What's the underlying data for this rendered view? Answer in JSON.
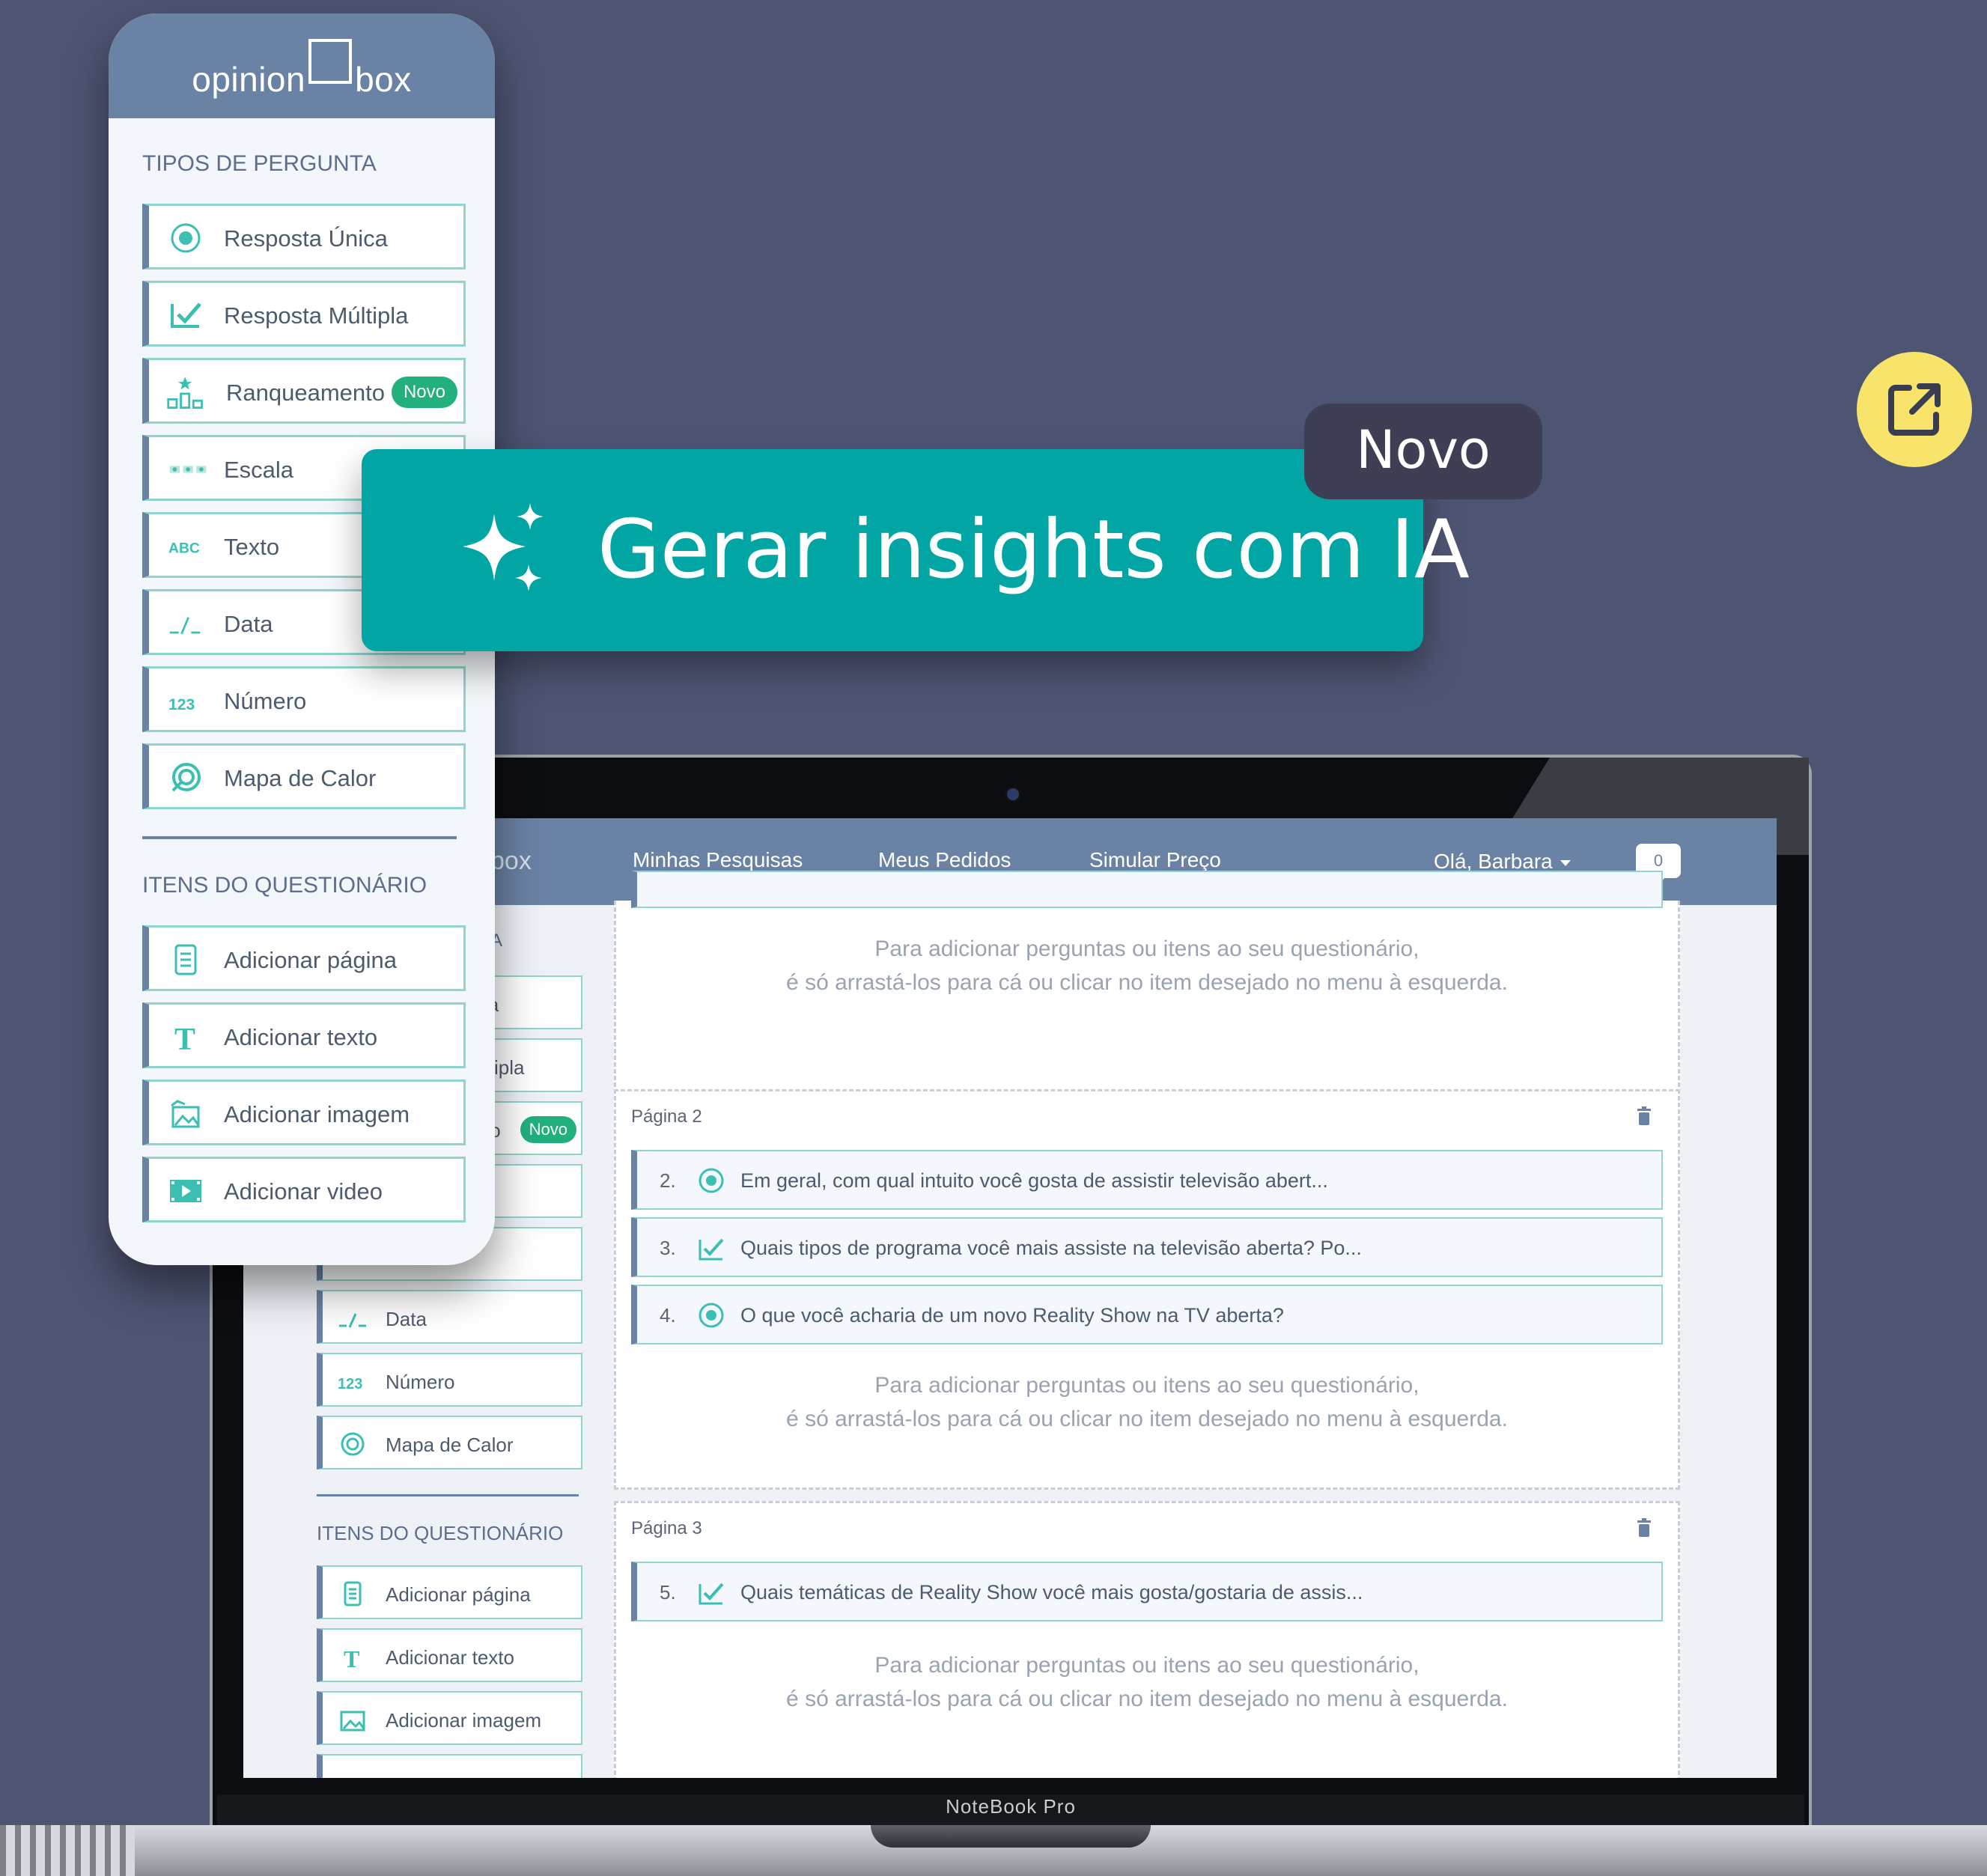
{
  "panel": {
    "logo_left": "opinion",
    "logo_right": "box",
    "question_types_heading": "TIPOS DE PERGUNTA",
    "question_types": [
      {
        "label": "Resposta Única",
        "icon": "radio-icon"
      },
      {
        "label": "Resposta Múltipla",
        "icon": "checkbox-icon"
      },
      {
        "label": "Ranqueamento",
        "icon": "ranking-icon",
        "badge": "Novo"
      },
      {
        "label": "Escala",
        "icon": "scale-icon"
      },
      {
        "label": "Texto",
        "icon": "abc-icon"
      },
      {
        "label": "Data",
        "icon": "date-icon"
      },
      {
        "label": "Número",
        "icon": "number-icon"
      },
      {
        "label": "Mapa de Calor",
        "icon": "heatmap-icon"
      }
    ],
    "items_heading": "ITENS DO QUESTIONÁRIO",
    "items": [
      {
        "label": "Adicionar página",
        "icon": "page-icon"
      },
      {
        "label": "Adicionar texto",
        "icon": "text-icon"
      },
      {
        "label": "Adicionar imagem",
        "icon": "image-icon"
      },
      {
        "label": "Adicionar video",
        "icon": "video-icon"
      }
    ]
  },
  "ia_card": {
    "label": "Gerar insights com IA",
    "tag": "Novo"
  },
  "laptop": {
    "label": "NoteBook Pro",
    "nav": {
      "logo_partial": "box",
      "links": [
        "Minhas Pesquisas",
        "Meus Pedidos",
        "Simular Preço"
      ],
      "user": "Olá, Barbara",
      "chat_count": "0"
    },
    "sidebar": {
      "partial_labels": [
        "A",
        "ica",
        "ltipla",
        "to"
      ],
      "partial_badge": "Novo",
      "types": [
        {
          "label": "Data"
        },
        {
          "label": "Número"
        },
        {
          "label": "Mapa de Calor"
        }
      ],
      "items_heading": "ITENS DO QUESTIONÁRIO",
      "items": [
        {
          "label": "Adicionar página"
        },
        {
          "label": "Adicionar texto"
        },
        {
          "label": "Adicionar imagem"
        }
      ]
    },
    "hint_line1": "Para adicionar perguntas ou itens ao seu questionário,",
    "hint_line2": "é só arrastá-los para cá ou clicar no item desejado no menu à esquerda.",
    "pages": [
      {
        "title": "Página 2",
        "questions": [
          {
            "num": "2.",
            "type": "radio-icon",
            "text": "Em geral, com qual intuito você gosta de assistir televisão abert..."
          },
          {
            "num": "3.",
            "type": "checkbox-icon",
            "text": "Quais tipos de programa você mais assiste na televisão aberta? Po..."
          },
          {
            "num": "4.",
            "type": "radio-icon",
            "text": "O que você acharia de um novo Reality Show na TV aberta?"
          }
        ]
      },
      {
        "title": "Página 3",
        "questions": [
          {
            "num": "5.",
            "type": "checkbox-icon",
            "text": "Quais temáticas de Reality Show você mais gosta/gostaria de assis..."
          }
        ]
      }
    ]
  },
  "colors": {
    "background": "#4e5573",
    "panel_header": "#6a82a4",
    "teal_accent": "#00a5a4",
    "badge_green": "#22b07d",
    "novo_tag": "#3e3f55",
    "external_button": "#f8e46b"
  }
}
